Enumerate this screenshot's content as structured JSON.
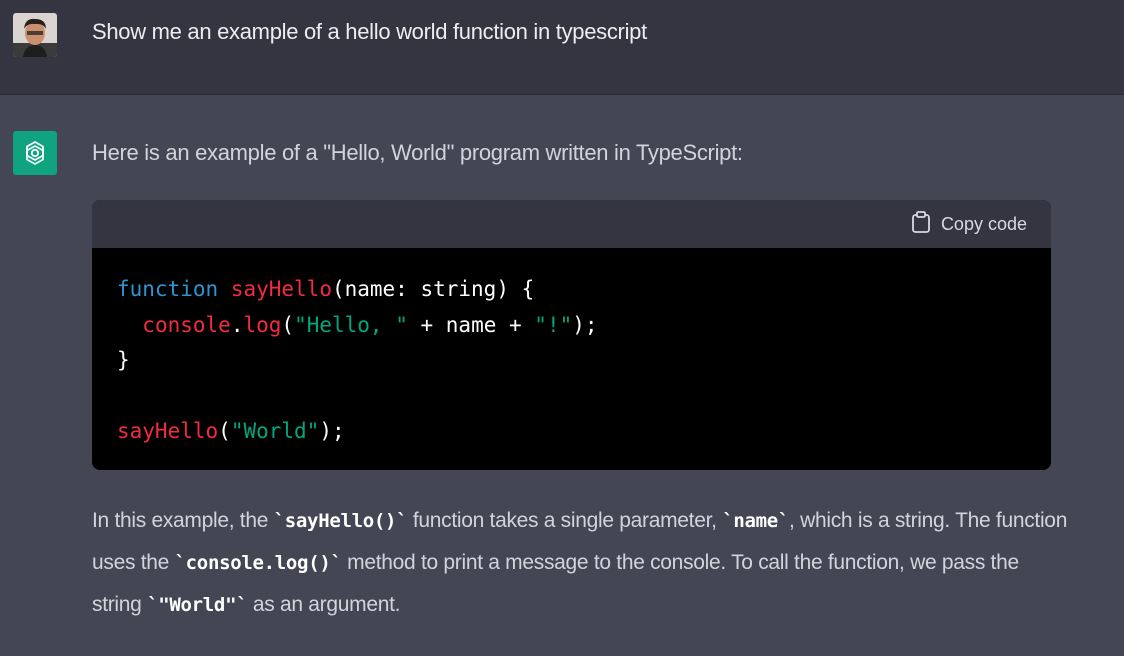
{
  "user_message": {
    "text": "Show me an example of a hello world function in  typescript"
  },
  "assistant_message": {
    "intro": "Here is an example of a \"Hello, World\" program written in TypeScript:",
    "code_block": {
      "copy_label": "Copy code",
      "lines": {
        "l1_keyword": "function",
        "l1_name": "sayHello",
        "l1_rest": "(name: string) {",
        "l2_indent": "  ",
        "l2_object": "console",
        "l2_dot": ".",
        "l2_method": "log",
        "l2_open": "(",
        "l2_str1": "\"Hello, \"",
        "l2_mid": " + name + ",
        "l2_str2": "\"!\"",
        "l2_close": ");",
        "l3": "}",
        "l5_name": "sayHello",
        "l5_open": "(",
        "l5_str": "\"World\"",
        "l5_close": ");"
      }
    },
    "explanation": {
      "p1": "In this example, the ",
      "c1": "`sayHello()`",
      "p2": " function takes a single parameter, ",
      "c2": "`name`",
      "p3": ", which is a string. The function uses the ",
      "c3": "`console.log()`",
      "p4": " method to print a message to the console. To call the function, we pass the string ",
      "c4": "`\"World\"`",
      "p5": " as an argument."
    }
  },
  "colors": {
    "user_bg": "#343541",
    "assistant_bg": "#444654",
    "gpt_logo_bg": "#10a37f",
    "code_keyword": "#2e95d3",
    "code_function": "#f22c3d",
    "code_string": "#00a67d"
  },
  "icons": {
    "avatar": "user-avatar",
    "assistant": "openai-logo-icon",
    "copy": "clipboard-icon"
  }
}
